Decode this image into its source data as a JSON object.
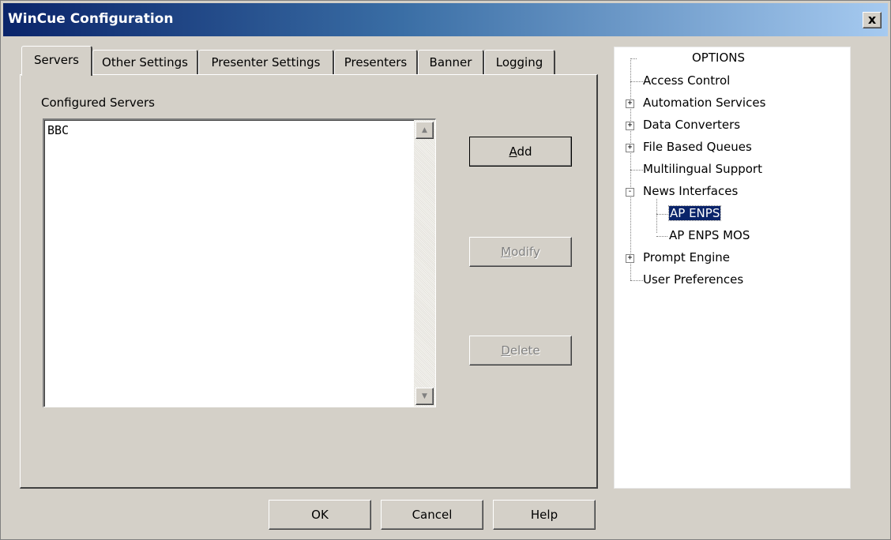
{
  "window": {
    "title": "WinCue Configuration",
    "close_label": "x"
  },
  "tabs": [
    {
      "label": "Servers",
      "active": true
    },
    {
      "label": "Other Settings",
      "active": false
    },
    {
      "label": "Presenter Settings",
      "active": false
    },
    {
      "label": "Presenters",
      "active": false
    },
    {
      "label": "Banner",
      "active": false
    },
    {
      "label": "Logging",
      "active": false
    }
  ],
  "servers": {
    "label": "Configured Servers",
    "items": [
      "BBC"
    ],
    "buttons": {
      "add": {
        "mnemonic": "A",
        "rest": "dd",
        "enabled": true
      },
      "modify": {
        "mnemonic": "M",
        "rest": "odify",
        "enabled": false
      },
      "delete": {
        "mnemonic": "D",
        "rest": "elete",
        "enabled": false
      }
    }
  },
  "footer": {
    "ok": "OK",
    "cancel": "Cancel",
    "help": "Help"
  },
  "tree": {
    "root": "OPTIONS",
    "items": [
      {
        "label": "Access Control",
        "expandable": false
      },
      {
        "label": "Automation Services",
        "expandable": true,
        "state": "+"
      },
      {
        "label": "Data Converters",
        "expandable": true,
        "state": "+"
      },
      {
        "label": "File Based Queues",
        "expandable": true,
        "state": "+"
      },
      {
        "label": "Multilingual Support",
        "expandable": false
      },
      {
        "label": "News Interfaces",
        "expandable": true,
        "state": "-"
      },
      {
        "label": "AP ENPS",
        "child": true,
        "selected": true
      },
      {
        "label": "AP ENPS MOS",
        "child": true
      },
      {
        "label": "Prompt Engine",
        "expandable": true,
        "state": "+"
      },
      {
        "label": "User Preferences",
        "expandable": false
      }
    ]
  },
  "colors": {
    "face": "#d4d0c8",
    "title_start": "#0a246a",
    "title_end": "#a6caf0",
    "selection": "#0a246a"
  }
}
